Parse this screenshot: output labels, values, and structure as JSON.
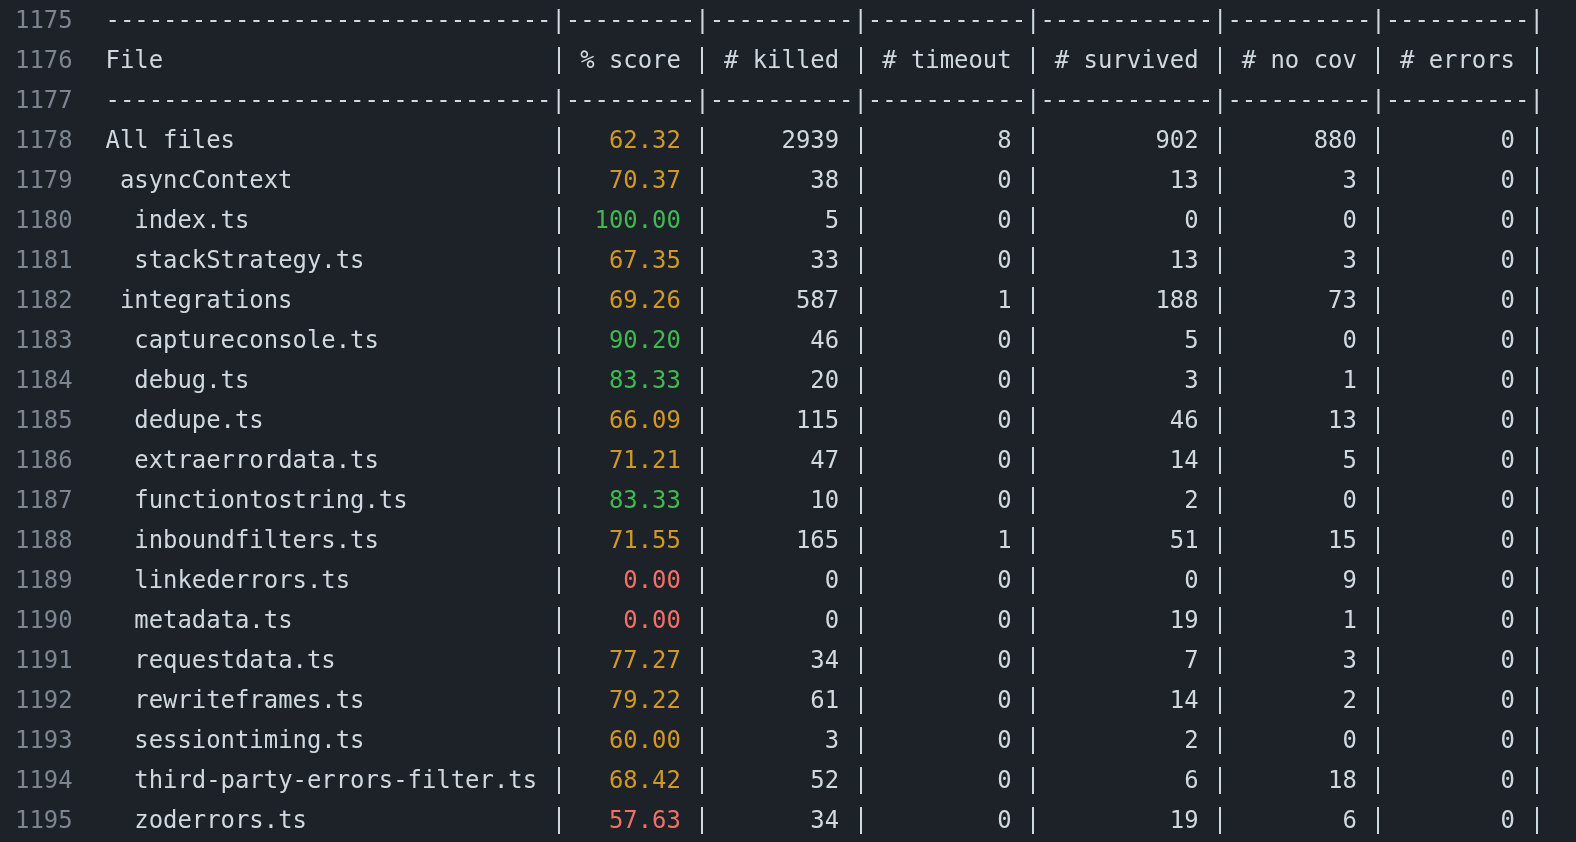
{
  "table": {
    "top_rule": {
      "line": "1175",
      "text": "-------------------------------|---------|----------|-----------|------------|----------|----------|"
    },
    "header": {
      "line": "1176",
      "cells": [
        "File",
        "% score",
        "# killed",
        "# timeout",
        "# survived",
        "# no cov",
        "# errors"
      ]
    },
    "header_rule": {
      "line": "1177",
      "text": "-------------------------------|---------|----------|-----------|------------|----------|----------|"
    },
    "rows": [
      {
        "line": "1178",
        "file": "All files",
        "score": "62.32",
        "color": "#d29922",
        "killed": "2939",
        "timeout": "8",
        "survived": "902",
        "no_cov": "880",
        "errors": "0",
        "children": [
          {
            "line": "1179",
            "file": "asyncContext",
            "score": "70.37",
            "color": "#d29922",
            "killed": "38",
            "timeout": "0",
            "survived": "13",
            "no_cov": "3",
            "errors": "0",
            "children": [
              {
                "line": "1180",
                "file": "index.ts",
                "score": "100.00",
                "color": "#3fb950",
                "killed": "5",
                "timeout": "0",
                "survived": "0",
                "no_cov": "0",
                "errors": "0"
              },
              {
                "line": "1181",
                "file": "stackStrategy.ts",
                "score": "67.35",
                "color": "#d29922",
                "killed": "33",
                "timeout": "0",
                "survived": "13",
                "no_cov": "3",
                "errors": "0"
              }
            ]
          },
          {
            "line": "1182",
            "file": "integrations",
            "score": "69.26",
            "color": "#d29922",
            "killed": "587",
            "timeout": "1",
            "survived": "188",
            "no_cov": "73",
            "errors": "0",
            "children": [
              {
                "line": "1183",
                "file": "captureconsole.ts",
                "score": "90.20",
                "color": "#3fb950",
                "killed": "46",
                "timeout": "0",
                "survived": "5",
                "no_cov": "0",
                "errors": "0"
              },
              {
                "line": "1184",
                "file": "debug.ts",
                "score": "83.33",
                "color": "#3fb950",
                "killed": "20",
                "timeout": "0",
                "survived": "3",
                "no_cov": "1",
                "errors": "0"
              },
              {
                "line": "1185",
                "file": "dedupe.ts",
                "score": "66.09",
                "color": "#d29922",
                "killed": "115",
                "timeout": "0",
                "survived": "46",
                "no_cov": "13",
                "errors": "0"
              },
              {
                "line": "1186",
                "file": "extraerrordata.ts",
                "score": "71.21",
                "color": "#d29922",
                "killed": "47",
                "timeout": "0",
                "survived": "14",
                "no_cov": "5",
                "errors": "0"
              },
              {
                "line": "1187",
                "file": "functiontostring.ts",
                "score": "83.33",
                "color": "#3fb950",
                "killed": "10",
                "timeout": "0",
                "survived": "2",
                "no_cov": "0",
                "errors": "0"
              },
              {
                "line": "1188",
                "file": "inboundfilters.ts",
                "score": "71.55",
                "color": "#d29922",
                "killed": "165",
                "timeout": "1",
                "survived": "51",
                "no_cov": "15",
                "errors": "0"
              },
              {
                "line": "1189",
                "file": "linkederrors.ts",
                "score": "0.00",
                "color": "#f47067",
                "killed": "0",
                "timeout": "0",
                "survived": "0",
                "no_cov": "9",
                "errors": "0"
              },
              {
                "line": "1190",
                "file": "metadata.ts",
                "score": "0.00",
                "color": "#f47067",
                "killed": "0",
                "timeout": "0",
                "survived": "19",
                "no_cov": "1",
                "errors": "0"
              },
              {
                "line": "1191",
                "file": "requestdata.ts",
                "score": "77.27",
                "color": "#d29922",
                "killed": "34",
                "timeout": "0",
                "survived": "7",
                "no_cov": "3",
                "errors": "0"
              },
              {
                "line": "1192",
                "file": "rewriteframes.ts",
                "score": "79.22",
                "color": "#d29922",
                "killed": "61",
                "timeout": "0",
                "survived": "14",
                "no_cov": "2",
                "errors": "0"
              },
              {
                "line": "1193",
                "file": "sessiontiming.ts",
                "score": "60.00",
                "color": "#d29922",
                "killed": "3",
                "timeout": "0",
                "survived": "2",
                "no_cov": "0",
                "errors": "0"
              },
              {
                "line": "1194",
                "file": "third-party-errors-filter.ts",
                "score": "68.42",
                "color": "#d29922",
                "killed": "52",
                "timeout": "0",
                "survived": "6",
                "no_cov": "18",
                "errors": "0"
              },
              {
                "line": "1195",
                "file": "zoderrors.ts",
                "score": "57.63",
                "color": "#f47067",
                "killed": "34",
                "timeout": "0",
                "survived": "19",
                "no_cov": "6",
                "errors": "0"
              }
            ]
          }
        ]
      }
    ]
  }
}
